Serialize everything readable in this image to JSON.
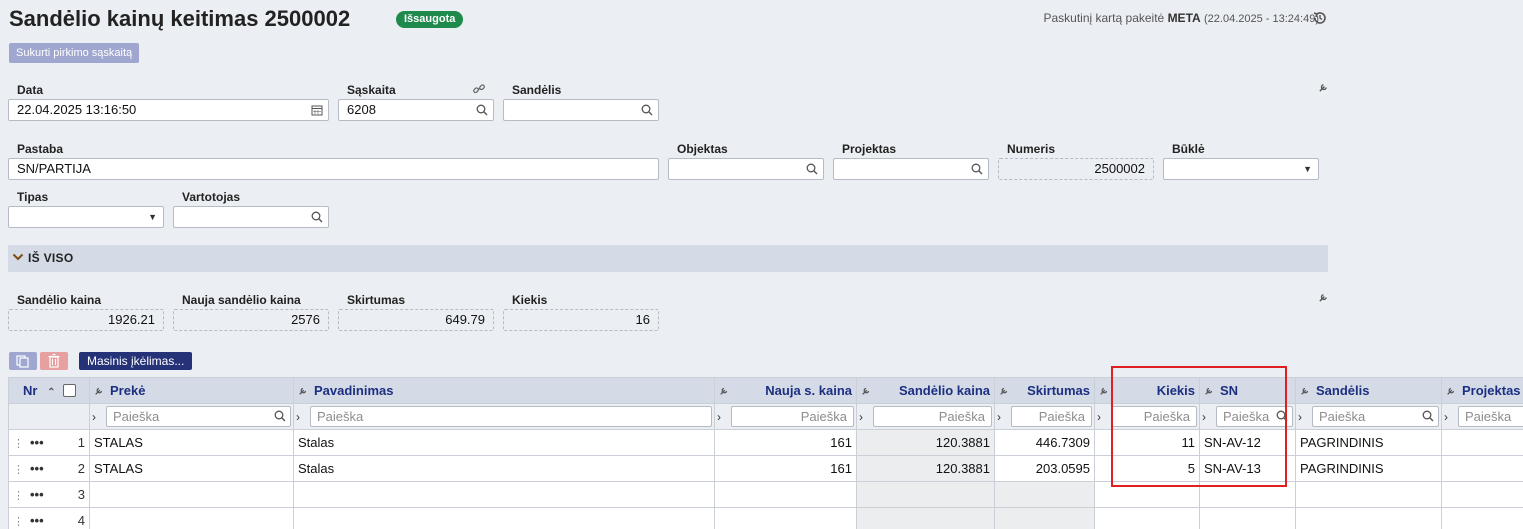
{
  "header": {
    "title": "Sandėlio kainų keitimas 2500002",
    "status_badge": "Išsaugota",
    "last_modified_prefix": "Paskutinį kartą pakeitė",
    "last_modified_user": "META",
    "last_modified_time": "(22.04.2025 - 13:24:49)",
    "create_invoice_button": "Sukurti pirkimo sąskaitą"
  },
  "form": {
    "data_label": "Data",
    "data_value": "22.04.2025 13:16:50",
    "saskaita_label": "Sąskaita",
    "saskaita_value": "6208",
    "sandelis_label": "Sandėlis",
    "sandelis_value": "",
    "pastaba_label": "Pastaba",
    "pastaba_value": "SN/PARTIJA",
    "objektas_label": "Objektas",
    "objektas_value": "",
    "projektas_label": "Projektas",
    "projektas_value": "",
    "numeris_label": "Numeris",
    "numeris_value": "2500002",
    "bukle_label": "Būklė",
    "bukle_value": "",
    "tipas_label": "Tipas",
    "tipas_value": "",
    "vartotojas_label": "Vartotojas",
    "vartotojas_value": ""
  },
  "totals": {
    "section_label": "IŠ VISO",
    "sandelio_kaina_label": "Sandėlio kaina",
    "sandelio_kaina_value": "1926.21",
    "nauja_label": "Nauja sandėlio kaina",
    "nauja_value": "2576",
    "skirtumas_label": "Skirtumas",
    "skirtumas_value": "649.79",
    "kiekis_label": "Kiekis",
    "kiekis_value": "16"
  },
  "toolbar": {
    "mass_import_button": "Masinis įkėlimas..."
  },
  "grid": {
    "search_placeholder": "Paieška",
    "columns": {
      "nr": "Nr",
      "preke": "Prekė",
      "pavadinimas": "Pavadinimas",
      "nauja_kaina": "Nauja s. kaina",
      "sandelio_kaina": "Sandėlio kaina",
      "skirtumas": "Skirtumas",
      "kiekis": "Kiekis",
      "sn": "SN",
      "sandelis": "Sandėlis",
      "projektas": "Projektas"
    },
    "rows": [
      {
        "nr": "1",
        "preke": "STALAS",
        "pavadinimas": "Stalas",
        "nauja_kaina": "161",
        "sandelio_kaina": "120.3881",
        "skirtumas": "446.7309",
        "kiekis": "11",
        "sn": "SN-AV-12",
        "sandelis": "PAGRINDINIS",
        "projektas": ""
      },
      {
        "nr": "2",
        "preke": "STALAS",
        "pavadinimas": "Stalas",
        "nauja_kaina": "161",
        "sandelio_kaina": "120.3881",
        "skirtumas": "203.0595",
        "kiekis": "5",
        "sn": "SN-AV-13",
        "sandelis": "PAGRINDINIS",
        "projektas": ""
      },
      {
        "nr": "3",
        "preke": "",
        "pavadinimas": "",
        "nauja_kaina": "",
        "sandelio_kaina": "",
        "skirtumas": "",
        "kiekis": "",
        "sn": "",
        "sandelis": "",
        "projektas": ""
      },
      {
        "nr": "4",
        "preke": "",
        "pavadinimas": "",
        "nauja_kaina": "",
        "sandelio_kaina": "",
        "skirtumas": "",
        "kiekis": "",
        "sn": "",
        "sandelis": "",
        "projektas": ""
      }
    ]
  },
  "colors": {
    "badge_green": "#1e8a4c",
    "header_blue": "#1c2f80",
    "navy_button": "#263277",
    "highlight_red": "#e02020"
  }
}
